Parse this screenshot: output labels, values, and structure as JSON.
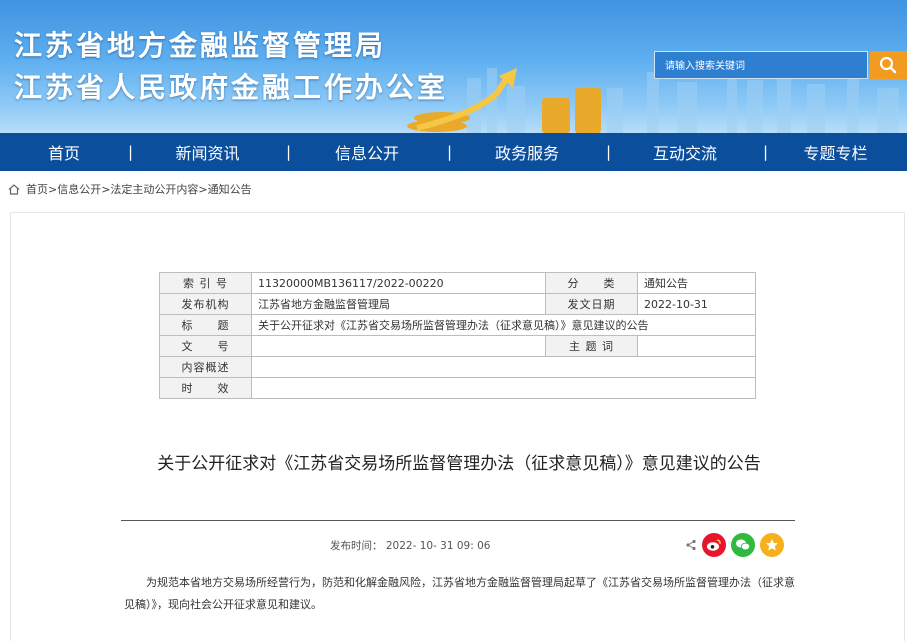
{
  "header": {
    "title_line1": "江苏省地方金融监督管理局",
    "title_line2": "江苏省人民政府金融工作办公室",
    "search_placeholder": "请输入搜索关键词"
  },
  "nav": {
    "items": [
      "首页",
      "新闻资讯",
      "信息公开",
      "政务服务",
      "互动交流",
      "专题专栏"
    ],
    "separator": "|"
  },
  "breadcrumb": {
    "text": "首页>信息公开>法定主动公开内容>通知公告"
  },
  "meta_table": {
    "index_no_label": "索 引 号",
    "index_no": "11320000MB136117/2022-00220",
    "category_label": "分　　类",
    "category": "通知公告",
    "publisher_label": "发布机构",
    "publisher": "江苏省地方金融监督管理局",
    "issue_date_label": "发文日期",
    "issue_date": "2022-10-31",
    "subject_label": "标　　题",
    "subject": "关于公开征求对《江苏省交易场所监督管理办法（征求意见稿）》意见建议的公告",
    "doc_no_label": "文　　号",
    "doc_no": "",
    "keywords_label": "主 题 词",
    "keywords": "",
    "summary_label": "内容概述",
    "summary": "",
    "validity_label": "时　　效",
    "validity": ""
  },
  "article": {
    "title": "关于公开征求对《江苏省交易场所监督管理办法（征求意见稿）》意见建议的公告",
    "publish_label": "发布时间：",
    "publish_time": "2022- 10- 31 09: 06",
    "body": "为规范本省地方交易场所经营行为，防范和化解金融风险，江苏省地方金融监督管理局起草了《江苏省交易场所监督管理办法（征求意见稿）》，现向社会公开征求意见和建议。"
  },
  "share": {
    "icons": [
      "share-icon",
      "weibo-icon",
      "wechat-icon",
      "favorite-icon"
    ]
  },
  "colors": {
    "nav_bg": "#0b4e9c",
    "search_button": "#f29b20",
    "weibo": "#e6162d",
    "wechat": "#2fba3f",
    "favorite": "#f5b01b"
  }
}
